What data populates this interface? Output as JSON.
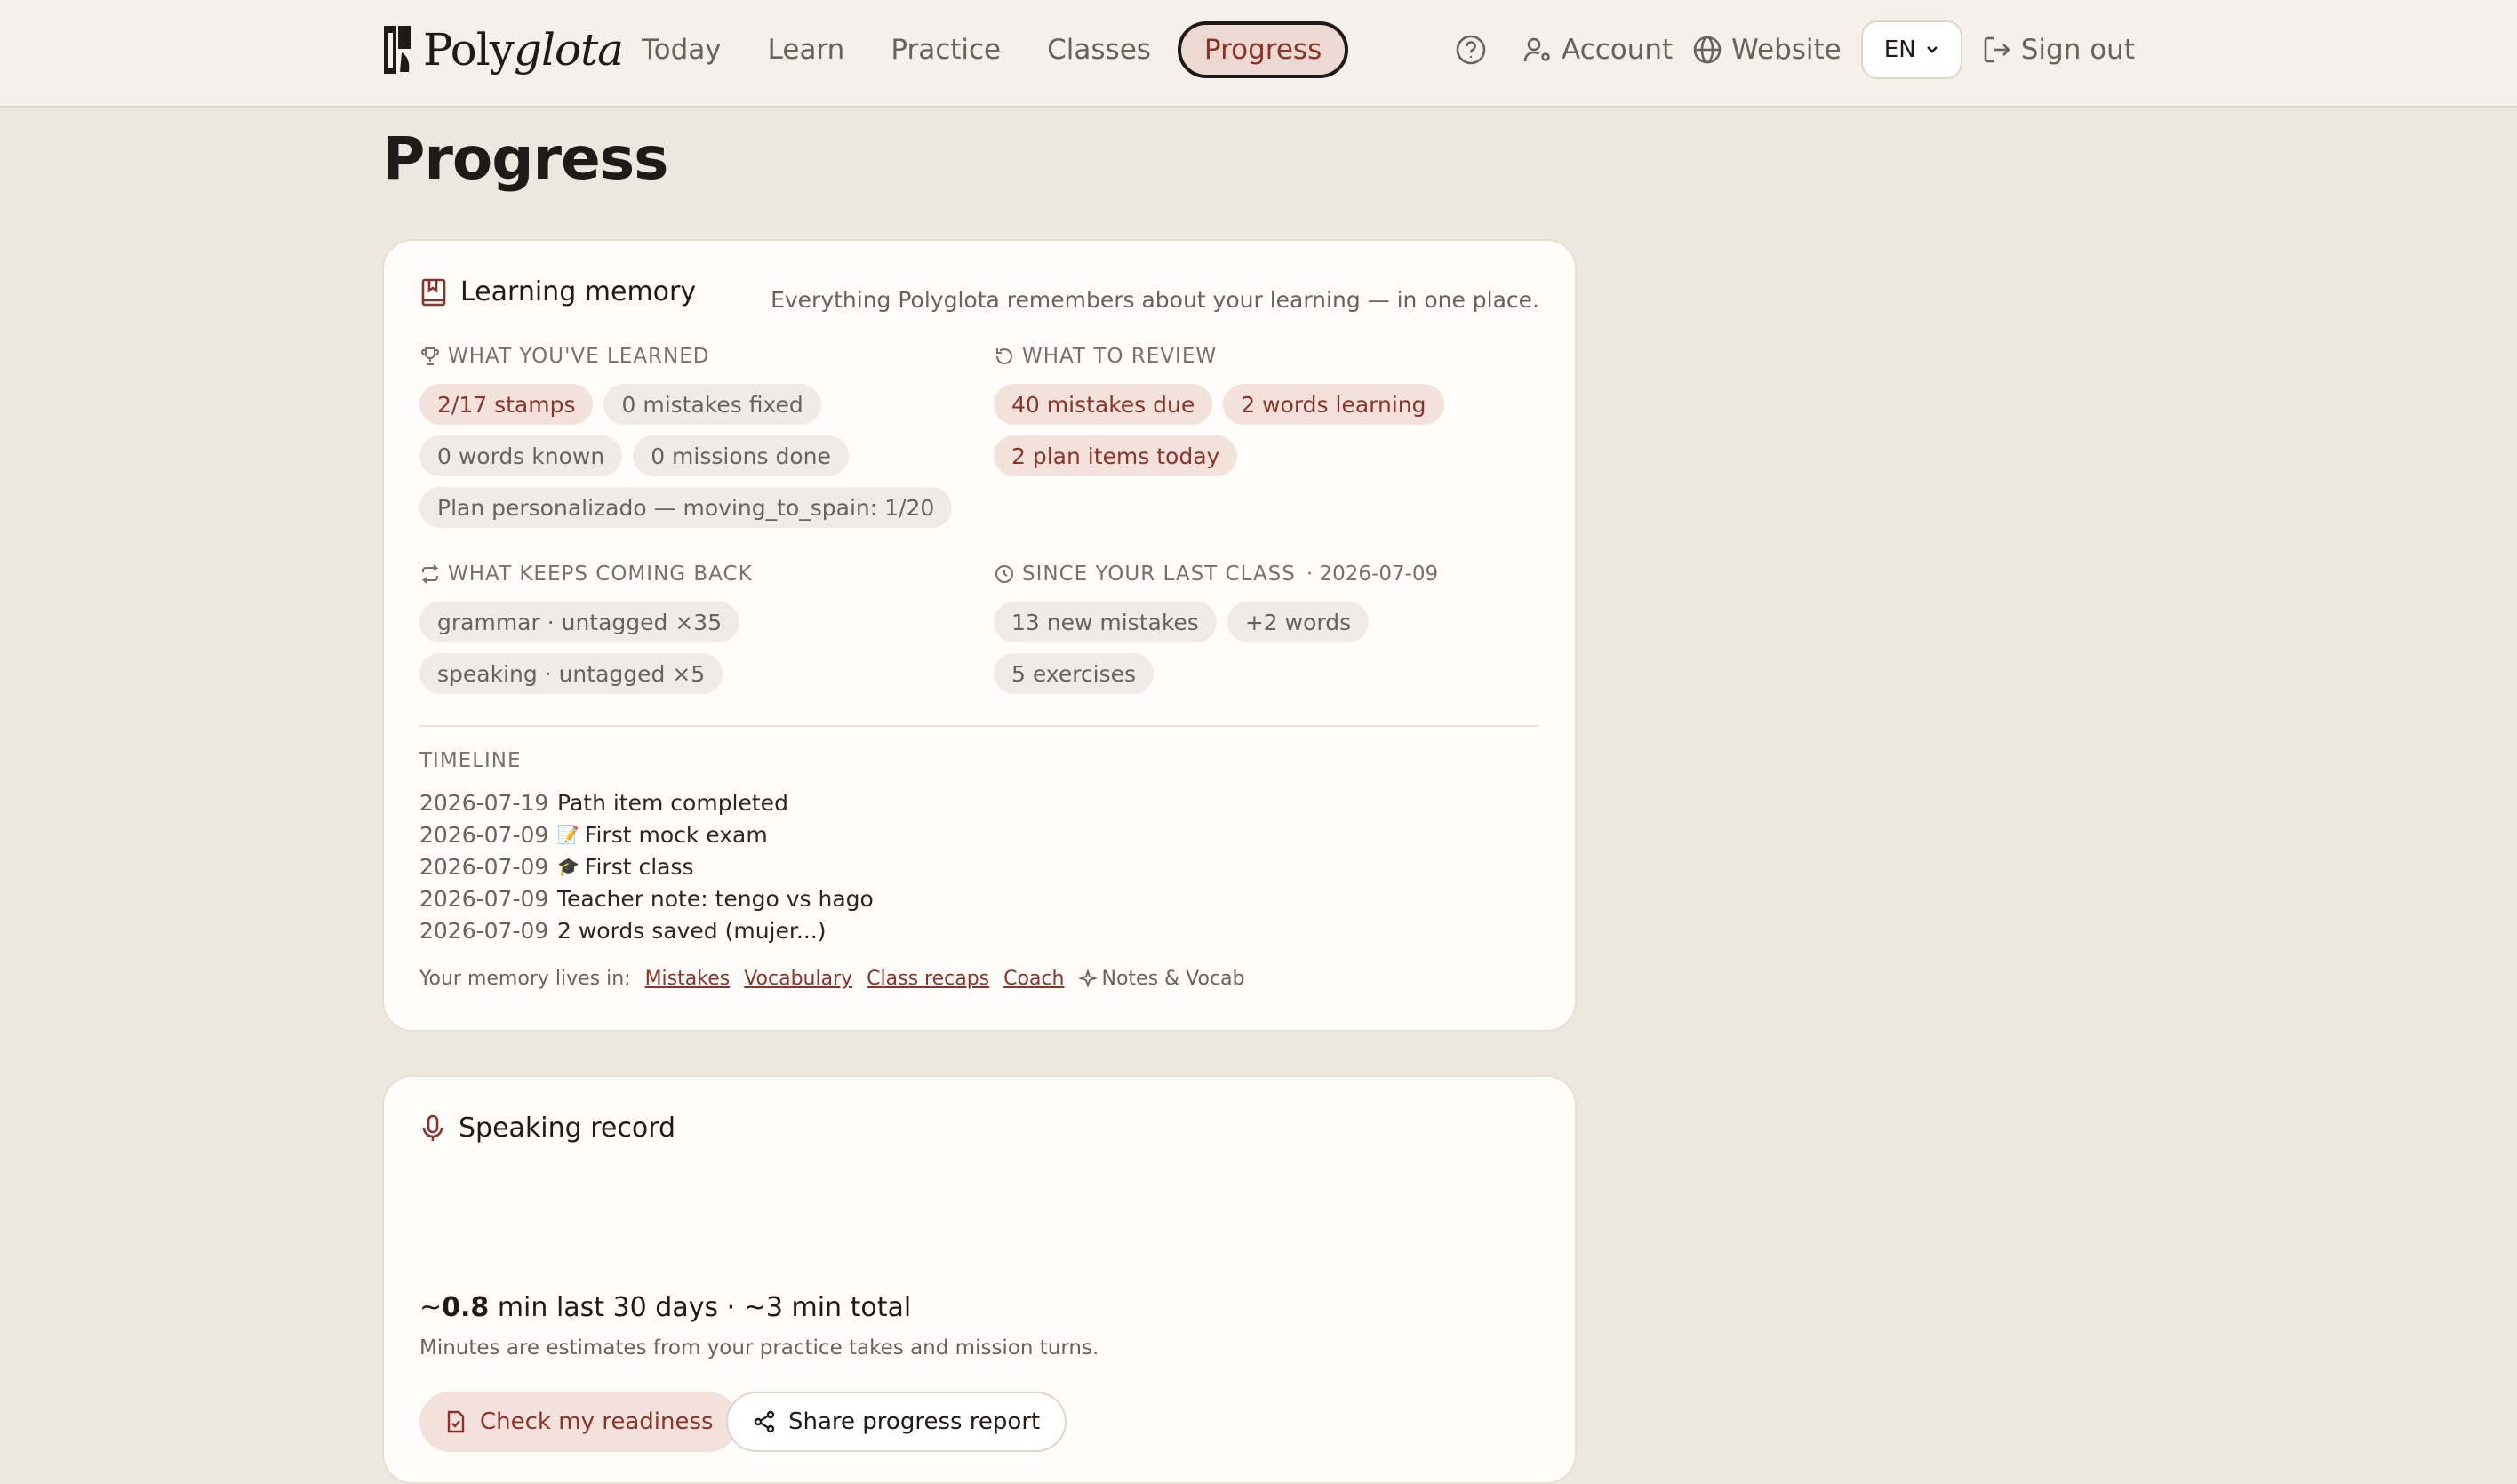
{
  "brand": {
    "name_plain": "Poly",
    "name_italic": "glota"
  },
  "nav": {
    "items": [
      {
        "label": "Today"
      },
      {
        "label": "Learn"
      },
      {
        "label": "Practice"
      },
      {
        "label": "Classes"
      },
      {
        "label": "Progress",
        "active": true
      }
    ]
  },
  "header_right": {
    "account": "Account",
    "website": "Website",
    "language": "EN",
    "signout": "Sign out"
  },
  "page": {
    "title": "Progress"
  },
  "memory": {
    "title": "Learning memory",
    "subtitle": "Everything Polyglota remembers about your learning — in one place.",
    "learned": {
      "heading": "WHAT YOU'VE LEARNED",
      "chips": [
        "2/17 stamps",
        "0 mistakes fixed",
        "0 words known",
        "0 missions done",
        "Plan personalizado — moving_to_spain: 1/20"
      ]
    },
    "review": {
      "heading": "WHAT TO REVIEW",
      "chips": [
        "40 mistakes due",
        "2 words learning",
        "2 plan items today"
      ]
    },
    "coming_back": {
      "heading": "WHAT KEEPS COMING BACK",
      "chips": [
        "grammar · untagged ×35",
        "speaking · untagged ×5"
      ]
    },
    "since_class": {
      "heading": "SINCE YOUR LAST CLASS",
      "date": "· 2026-07-09",
      "chips": [
        "13 new mistakes",
        "+2 words",
        "5 exercises"
      ]
    },
    "timeline": {
      "heading": "TIMELINE",
      "rows": [
        {
          "date": "2026-07-19",
          "emoji": "",
          "text": "Path item completed"
        },
        {
          "date": "2026-07-09",
          "emoji": "📝",
          "text": "First mock exam"
        },
        {
          "date": "2026-07-09",
          "emoji": "🎓",
          "text": "First class"
        },
        {
          "date": "2026-07-09",
          "emoji": "",
          "text": "Teacher note: tengo vs hago"
        },
        {
          "date": "2026-07-09",
          "emoji": "",
          "text": "2 words saved (mujer...)"
        }
      ]
    },
    "lives_in": {
      "label": "Your memory lives in:",
      "links": [
        "Mistakes",
        "Vocabulary",
        "Class recaps",
        "Coach"
      ],
      "notes": "Notes & Vocab"
    }
  },
  "speaking": {
    "title": "Speaking record",
    "stat_prefix": "~",
    "stat_value": "0.8",
    "stat_suffix": " min last 30 days · ~3 min total",
    "note": "Minutes are estimates from your practice takes and mission turns.",
    "readiness_btn": "Check my readiness",
    "share_btn": "Share progress report"
  },
  "colors": {
    "accent": "#8a3328",
    "accent_bg": "#f3e2dc",
    "background": "#ede8df",
    "card": "#fffdfa"
  }
}
